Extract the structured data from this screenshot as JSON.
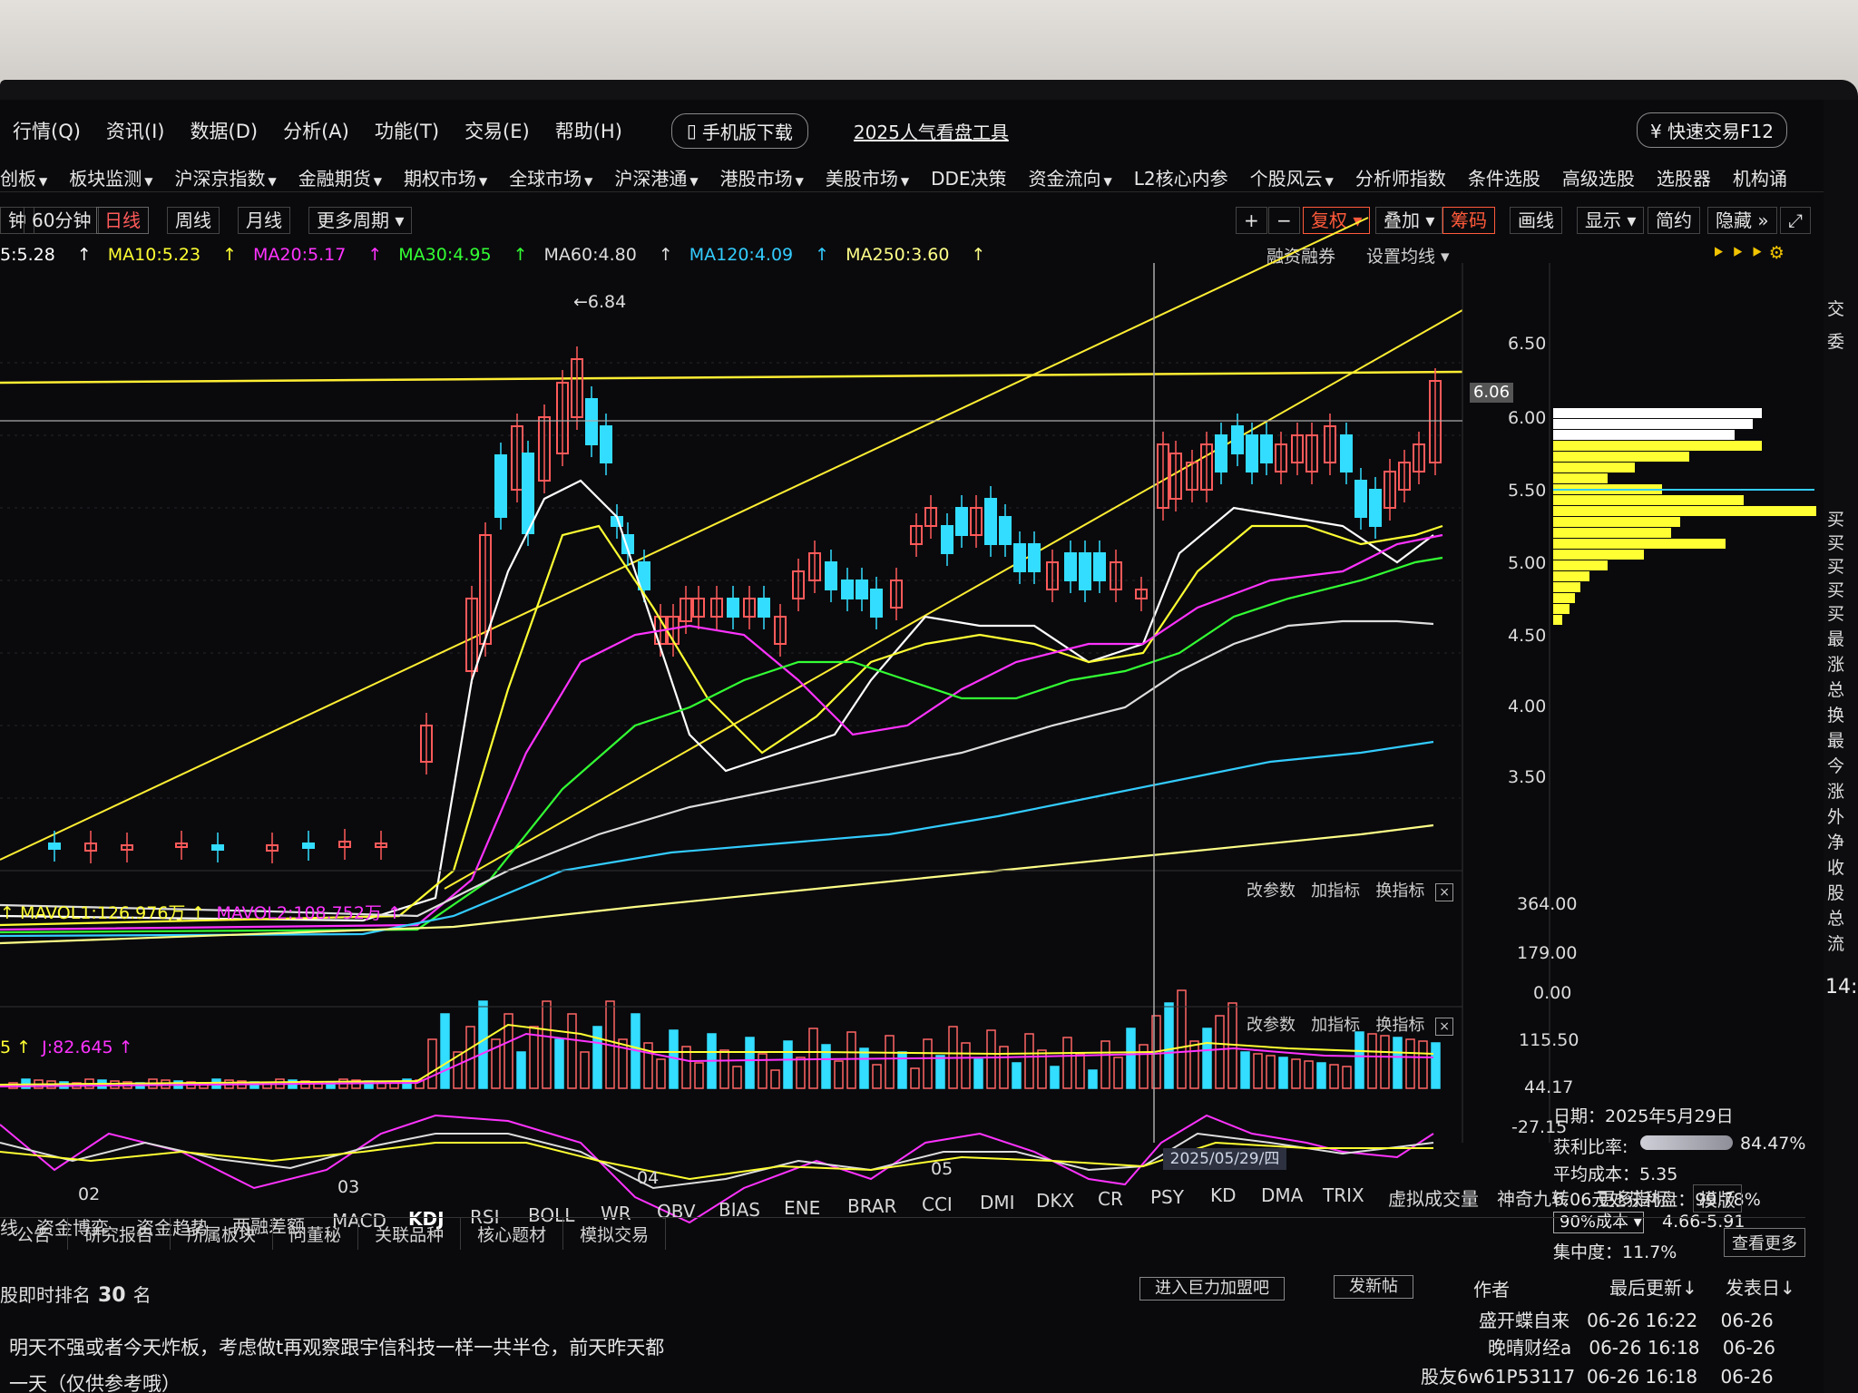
{
  "menubar": {
    "items": [
      "行情(Q)",
      "资讯(I)",
      "数据(D)",
      "分析(A)",
      "功能(T)",
      "交易(E)",
      "帮助(H)"
    ],
    "mobile_download": "手机版下载",
    "popular_tool": "2025人气看盘工具",
    "quick_trade": "快速交易F12"
  },
  "navbar": {
    "items": [
      "创板",
      "板块监测",
      "沪深京指数",
      "金融期货",
      "期权市场",
      "全球市场",
      "沪深港通",
      "港股市场",
      "美股市场",
      "DDE决策",
      "资金流向",
      "L2核心内参",
      "个股风云",
      "分析师指数",
      "条件选股",
      "高级选股",
      "选股器",
      "机构诵"
    ]
  },
  "periods": {
    "partial": "钟",
    "min60": "60分钟",
    "daily": "日线",
    "weekly": "周线",
    "monthly": "月线",
    "more": "更多周期"
  },
  "toolbar": {
    "plus": "+",
    "minus": "−",
    "fuquan": "复权",
    "overlay": "叠加",
    "chips": "筹码",
    "draw": "画线",
    "display": "显示",
    "simple": "简约",
    "hide": "隐藏",
    "expand": "»"
  },
  "ma_legend": {
    "ma5": "5:5.28",
    "ma10": "MA10:5.23",
    "ma20": "MA20:5.17",
    "ma30": "MA30:4.95",
    "ma60": "MA60:4.80",
    "ma120": "MA120:4.09",
    "ma250": "MA250:3.60",
    "colors": {
      "ma5": "#ffffff",
      "ma10": "#ffff33",
      "ma20": "#ff33ff",
      "ma30": "#33ff33",
      "ma60": "#dddddd",
      "ma120": "#33ccff",
      "ma250": "#ffff88"
    }
  },
  "chart_links": {
    "margin": "融资融券",
    "set_ma": "设置均线"
  },
  "price_axis": {
    "labels": [
      "6.50",
      "6.00",
      "5.50",
      "5.00",
      "4.50",
      "4.00",
      "3.50"
    ],
    "current": "6.06",
    "high_marker": "6.84"
  },
  "sub_tools": {
    "change_params": "改参数",
    "add_indicator": "加指标",
    "switch_indicator": "换指标",
    "close": "×"
  },
  "volume": {
    "mavol1": "MAVOL1:126.976万",
    "mavol2": "MAVOL2:108.752万",
    "axis": [
      "364.00",
      "179.00",
      "0.00"
    ]
  },
  "kdj": {
    "k_partial": "5",
    "j": "J:82.645",
    "axis": [
      "115.50",
      "44.17",
      "-27.15"
    ]
  },
  "months": [
    "02",
    "03",
    "04",
    "05"
  ],
  "date_cursor": "2025/05/29/四",
  "chip_panel": {
    "date": "日期：2025年5月29日",
    "profit_ratio_label": "获利比率:",
    "profit_ratio_value": "84.47%",
    "avg_cost": "平均成本：5.35",
    "profit_at_price": "6.06元处获利盘：99.78%",
    "cost_select": "90%成本",
    "cost_range": "4.66-5.91",
    "concentration": "集中度：11.7%"
  },
  "indicator_tabs": [
    "线",
    "资金博弈",
    "资金趋势",
    "两融差额",
    "MACD",
    "KDJ",
    "RSI",
    "BOLL",
    "WR",
    "OBV",
    "BIAS",
    "ENE",
    "BRAR",
    "CCI",
    "DMI",
    "DKX",
    "CR",
    "PSY",
    "KD",
    "DMA",
    "TRIX",
    "虚拟成交量",
    "神奇九转",
    "更多指标",
    "模版"
  ],
  "bottom_tabs": [
    "公告",
    "研究报告",
    "所属板块",
    "问董秘",
    "关联品种",
    "核心题材",
    "模拟交易"
  ],
  "view_more": "查看更多",
  "rank": {
    "label": "股即时排名",
    "value": "30",
    "suffix": "名"
  },
  "posts": {
    "btn_top_user": "进入巨力加盟吧",
    "btn_new_post": "发新帖",
    "col_author": "作者",
    "col_updated": "最后更新↓",
    "col_posted": "发表日↓",
    "text1": "明天不强或者今天炸板，考虑做t再观察跟宇信科技一样一共半仓，前天昨天都",
    "text2": "一天（仅供参考哦）",
    "rows": [
      {
        "author": "盛开蝶自来",
        "updated": "06-26 16:22",
        "posted": "06-26"
      },
      {
        "author": "晚晴财经a",
        "updated": "06-26 16:18",
        "posted": "06-26"
      },
      {
        "author": "股友6w61P53117",
        "updated": "06-26 16:18",
        "posted": "06-26"
      }
    ]
  },
  "right_strip": {
    "labels": [
      "交",
      "委",
      "买",
      "买",
      "买",
      "买",
      "买",
      "最",
      "涨",
      "总",
      "换",
      "最",
      "今",
      "涨",
      "外",
      "净",
      "收",
      "股",
      "总",
      "流"
    ],
    "time": "14:"
  }
}
